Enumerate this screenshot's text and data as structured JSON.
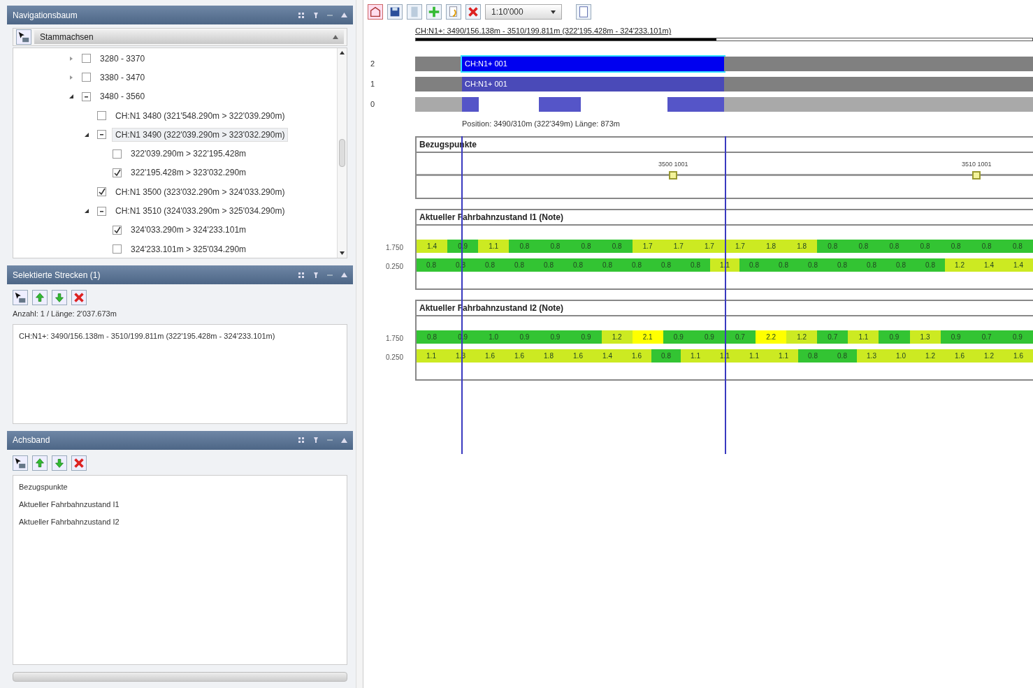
{
  "panels": [
    {
      "title": "Navigationsbaum",
      "kind": "tree"
    },
    {
      "title": "Selektierte Strecken (1)",
      "kind": "selection"
    },
    {
      "title": "Achsband",
      "kind": "layers"
    }
  ],
  "tree": {
    "dropdown": "Stammachsen",
    "items": [
      {
        "label": "3280 - 3370",
        "checked": false,
        "partial": false,
        "expanded": false,
        "highlighted": false
      },
      {
        "label": "3380 - 3470",
        "checked": false,
        "partial": false,
        "expanded": false,
        "highlighted": false
      },
      {
        "label": "3480 - 3560",
        "checked": false,
        "partial": true,
        "expanded": true,
        "highlighted": false,
        "children": [
          {
            "label": "CH:N1 3480 (321'548.290m > 322'039.290m)",
            "checked": false,
            "partial": false,
            "highlighted": false
          },
          {
            "label": "CH:N1 3490 (322'039.290m > 323'032.290m)",
            "checked": false,
            "partial": true,
            "expanded": true,
            "highlighted": true,
            "children": [
              {
                "label": "322'039.290m > 322'195.428m",
                "checked": false,
                "partial": false,
                "highlighted": false
              },
              {
                "label": "322'195.428m > 323'032.290m",
                "checked": true,
                "partial": false,
                "highlighted": false
              }
            ]
          },
          {
            "label": "CH:N1 3500 (323'032.290m > 324'033.290m)",
            "checked": true,
            "partial": false,
            "highlighted": false
          },
          {
            "label": "CH:N1 3510 (324'033.290m > 325'034.290m)",
            "checked": false,
            "partial": true,
            "expanded": true,
            "highlighted": false,
            "children": [
              {
                "label": "324'033.290m > 324'233.101m",
                "checked": true,
                "partial": false,
                "highlighted": false
              },
              {
                "label": "324'233.101m > 325'034.290m",
                "checked": false,
                "partial": false,
                "highlighted": false
              }
            ]
          }
        ]
      }
    ]
  },
  "selection": {
    "summary": "Anzahl: 1 / Länge: 2'037.673m",
    "entries": [
      "CH:N1+: 3490/156.138m - 3510/199.811m (322'195.428m - 324'233.101m)"
    ]
  },
  "layers": [
    "Bezugspunkte",
    "Aktueller Fahrbahnzustand I1",
    "Aktueller Fahrbahnzustand I2"
  ],
  "toolbar": {
    "scale": "1:10'000"
  },
  "route": "CH:N1+: 3490/156.138m - 3510/199.811m (322'195.428m - 324'233.101m)",
  "tracks": [
    {
      "label": "2",
      "kind": "single",
      "segment": "CH:N1+ 001",
      "selected": true
    },
    {
      "label": "1",
      "kind": "single",
      "segment": "CH:N1+ 001",
      "selected": false
    },
    {
      "label": "0",
      "kind": "pieces",
      "selected": false
    }
  ],
  "position": "Position: 3490/310m (322'349m) Länge: 873m",
  "reference": {
    "title": "Bezugspunkte",
    "points": [
      "3500 1001",
      "3510 1001"
    ]
  },
  "conditions": [
    {
      "title": "Aktueller Fahrbahnzustand I1 (Note)",
      "rows": [
        {
          "label": "1.750",
          "segments": [
            {
              "text": "1.4",
              "color": "#ccea22"
            },
            {
              "text": "0.9",
              "color": "#33c433"
            },
            {
              "text": "1.1",
              "color": "#ccea22"
            },
            {
              "text": "0.8",
              "color": "#33c433"
            },
            {
              "text": "0.8",
              "color": "#33c433"
            },
            {
              "text": "0.8",
              "color": "#33c433"
            },
            {
              "text": "0.8",
              "color": "#33c433"
            },
            {
              "text": "1.7",
              "color": "#ccea22"
            },
            {
              "text": "1.7",
              "color": "#ccea22"
            },
            {
              "text": "1.7",
              "color": "#ccea22"
            },
            {
              "text": "1.7",
              "color": "#ccea22"
            },
            {
              "text": "1.8",
              "color": "#ccea22"
            },
            {
              "text": "1.8",
              "color": "#ccea22"
            },
            {
              "text": "0.8",
              "color": "#33c433"
            },
            {
              "text": "0.8",
              "color": "#33c433"
            },
            {
              "text": "0.8",
              "color": "#33c433"
            },
            {
              "text": "0.8",
              "color": "#33c433"
            },
            {
              "text": "0.8",
              "color": "#33c433"
            },
            {
              "text": "0.8",
              "color": "#33c433"
            },
            {
              "text": "0.8",
              "color": "#33c433"
            }
          ]
        },
        {
          "label": "0.250",
          "segments": [
            {
              "text": "0.8",
              "color": "#33c433"
            },
            {
              "text": "0.8",
              "color": "#33c433"
            },
            {
              "text": "0.8",
              "color": "#33c433"
            },
            {
              "text": "0.8",
              "color": "#33c433"
            },
            {
              "text": "0.8",
              "color": "#33c433"
            },
            {
              "text": "0.8",
              "color": "#33c433"
            },
            {
              "text": "0.8",
              "color": "#33c433"
            },
            {
              "text": "0.8",
              "color": "#33c433"
            },
            {
              "text": "0.8",
              "color": "#33c433"
            },
            {
              "text": "0.8",
              "color": "#33c433"
            },
            {
              "text": "1.1",
              "color": "#ccea22"
            },
            {
              "text": "0.8",
              "color": "#33c433"
            },
            {
              "text": "0.8",
              "color": "#33c433"
            },
            {
              "text": "0.8",
              "color": "#33c433"
            },
            {
              "text": "0.8",
              "color": "#33c433"
            },
            {
              "text": "0.8",
              "color": "#33c433"
            },
            {
              "text": "0.8",
              "color": "#33c433"
            },
            {
              "text": "0.8",
              "color": "#33c433"
            },
            {
              "text": "1.2",
              "color": "#ccea22"
            },
            {
              "text": "1.4",
              "color": "#ccea22"
            },
            {
              "text": "1.4",
              "color": "#ccea22"
            }
          ]
        }
      ]
    },
    {
      "title": "Aktueller Fahrbahnzustand I2 (Note)",
      "rows": [
        {
          "label": "1.750",
          "segments": [
            {
              "text": "0.8",
              "color": "#33c433"
            },
            {
              "text": "0.9",
              "color": "#33c433"
            },
            {
              "text": "1.0",
              "color": "#33c433"
            },
            {
              "text": "0.9",
              "color": "#33c433"
            },
            {
              "text": "0.9",
              "color": "#33c433"
            },
            {
              "text": "0.9",
              "color": "#33c433"
            },
            {
              "text": "1.2",
              "color": "#ccea22"
            },
            {
              "text": "2.1",
              "color": "#ffff00"
            },
            {
              "text": "0.9",
              "color": "#33c433"
            },
            {
              "text": "0.9",
              "color": "#33c433"
            },
            {
              "text": "0.7",
              "color": "#33c433"
            },
            {
              "text": "2.2",
              "color": "#ffff00"
            },
            {
              "text": "1.2",
              "color": "#ccea22"
            },
            {
              "text": "0.7",
              "color": "#33c433"
            },
            {
              "text": "1.1",
              "color": "#ccea22"
            },
            {
              "text": "0.9",
              "color": "#33c433"
            },
            {
              "text": "1.3",
              "color": "#ccea22"
            },
            {
              "text": "0.9",
              "color": "#33c433"
            },
            {
              "text": "0.7",
              "color": "#33c433"
            },
            {
              "text": "0.9",
              "color": "#33c433"
            }
          ]
        },
        {
          "label": "0.250",
          "segments": [
            {
              "text": "1.1",
              "color": "#ccea22"
            },
            {
              "text": "1.3",
              "color": "#ccea22"
            },
            {
              "text": "1.6",
              "color": "#ccea22"
            },
            {
              "text": "1.6",
              "color": "#ccea22"
            },
            {
              "text": "1.8",
              "color": "#ccea22"
            },
            {
              "text": "1.6",
              "color": "#ccea22"
            },
            {
              "text": "1.4",
              "color": "#ccea22"
            },
            {
              "text": "1.6",
              "color": "#ccea22"
            },
            {
              "text": "0.8",
              "color": "#33c433"
            },
            {
              "text": "1.1",
              "color": "#ccea22"
            },
            {
              "text": "1.1",
              "color": "#ccea22"
            },
            {
              "text": "1.1",
              "color": "#ccea22"
            },
            {
              "text": "1.1",
              "color": "#ccea22"
            },
            {
              "text": "0.8",
              "color": "#33c433"
            },
            {
              "text": "0.8",
              "color": "#33c433"
            },
            {
              "text": "1.3",
              "color": "#ccea22"
            },
            {
              "text": "1.0",
              "color": "#ccea22"
            },
            {
              "text": "1.2",
              "color": "#ccea22"
            },
            {
              "text": "1.6",
              "color": "#ccea22"
            },
            {
              "text": "1.2",
              "color": "#ccea22"
            },
            {
              "text": "1.6",
              "color": "#ccea22"
            }
          ]
        }
      ]
    }
  ]
}
